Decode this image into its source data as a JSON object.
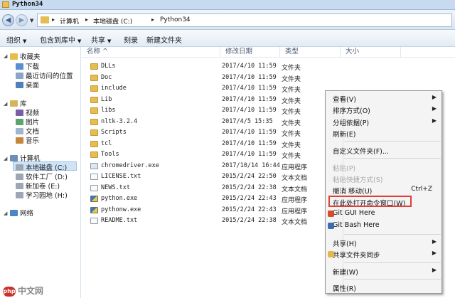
{
  "window": {
    "title": "Python34"
  },
  "address": {
    "crumbs": [
      "计算机",
      "本地磁盘 (C:)",
      "Python34"
    ]
  },
  "toolbar": {
    "items": [
      {
        "label": "组织",
        "dropdown": true
      },
      {
        "label": "包含到库中",
        "dropdown": true
      },
      {
        "label": "共享",
        "dropdown": true
      },
      {
        "label": "刻录",
        "dropdown": false
      },
      {
        "label": "新建文件夹",
        "dropdown": false
      }
    ]
  },
  "nav": {
    "favorites": {
      "label": "收藏夹",
      "items": [
        "下载",
        "最近访问的位置",
        "桌面"
      ]
    },
    "libraries": {
      "label": "库",
      "items": [
        "视频",
        "图片",
        "文档",
        "音乐"
      ]
    },
    "computer": {
      "label": "计算机",
      "items": [
        "本地磁盘 (C:)",
        "软件工厂 (D:)",
        "新加卷 (E:)",
        "学习园地 (H:)"
      ]
    },
    "network": {
      "label": "网络"
    }
  },
  "columns": {
    "name": "名称",
    "date": "修改日期",
    "type": "类型",
    "size": "大小"
  },
  "files": [
    {
      "name": "DLLs",
      "date": "2017/4/10 11:59",
      "type": "文件夹",
      "kind": "folder"
    },
    {
      "name": "Doc",
      "date": "2017/4/10 11:59",
      "type": "文件夹",
      "kind": "folder"
    },
    {
      "name": "include",
      "date": "2017/4/10 11:59",
      "type": "文件夹",
      "kind": "folder"
    },
    {
      "name": "Lib",
      "date": "2017/4/10 11:59",
      "type": "文件夹",
      "kind": "folder"
    },
    {
      "name": "libs",
      "date": "2017/4/10 11:59",
      "type": "文件夹",
      "kind": "folder"
    },
    {
      "name": "nltk-3.2.4",
      "date": "2017/4/5 15:35",
      "type": "文件夹",
      "kind": "folder"
    },
    {
      "name": "Scripts",
      "date": "2017/4/10 11:59",
      "type": "文件夹",
      "kind": "folder"
    },
    {
      "name": "tcl",
      "date": "2017/4/10 11:59",
      "type": "文件夹",
      "kind": "folder"
    },
    {
      "name": "Tools",
      "date": "2017/4/10 11:59",
      "type": "文件夹",
      "kind": "folder"
    },
    {
      "name": "chromedriver.exe",
      "date": "2017/10/14 16:44",
      "type": "应用程序",
      "kind": "exe"
    },
    {
      "name": "LICENSE.txt",
      "date": "2015/2/24 22:50",
      "type": "文本文档",
      "kind": "txt"
    },
    {
      "name": "NEWS.txt",
      "date": "2015/2/24 22:38",
      "type": "文本文档",
      "kind": "txt"
    },
    {
      "name": "python.exe",
      "date": "2015/2/24 22:43",
      "type": "应用程序",
      "kind": "py"
    },
    {
      "name": "pythonw.exe",
      "date": "2015/2/24 22:43",
      "type": "应用程序",
      "kind": "py"
    },
    {
      "name": "README.txt",
      "date": "2015/2/24 22:38",
      "type": "文本文档",
      "kind": "txt"
    }
  ],
  "context_menu": {
    "view": "查看(V)",
    "sort": "排序方式(O)",
    "group": "分组依据(P)",
    "refresh": "刷新(E)",
    "customize": "自定义文件夹(F)...",
    "paste": "粘贴(P)",
    "paste_shortcut": "粘贴快捷方式(S)",
    "undo_move": "撤消 移动(U)",
    "undo_shortcut": "Ctrl+Z",
    "open_cmd": "在此处打开命令窗口(W)",
    "git_gui": "Git GUI Here",
    "git_bash": "Git Bash Here",
    "share": "共享(H)",
    "sync": "共享文件夹同步",
    "new": "新建(W)",
    "properties": "属性(R)"
  },
  "watermark": {
    "logo": "php",
    "text": "中文网"
  }
}
